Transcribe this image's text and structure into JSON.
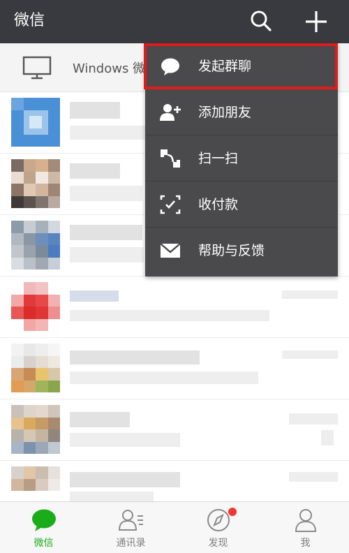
{
  "header": {
    "title": "微信",
    "search_icon": "search-icon",
    "add_icon": "plus-icon"
  },
  "banner": {
    "text": "Windows 微",
    "icon": "monitor-icon"
  },
  "menu": {
    "items": [
      {
        "label": "发起群聊",
        "icon": "chat-bubble-icon",
        "highlighted": true
      },
      {
        "label": "添加朋友",
        "icon": "add-friend-icon",
        "highlighted": false
      },
      {
        "label": "扫一扫",
        "icon": "scan-icon",
        "highlighted": false
      },
      {
        "label": "收付款",
        "icon": "payment-icon",
        "highlighted": false
      },
      {
        "label": "帮助与反馈",
        "icon": "envelope-icon",
        "highlighted": false
      }
    ],
    "highlight_color": "#e01b1b"
  },
  "tabbar": {
    "tabs": [
      {
        "label": "微信",
        "icon": "chat-icon",
        "active": true
      },
      {
        "label": "通讯录",
        "icon": "contacts-icon",
        "active": false
      },
      {
        "label": "发现",
        "icon": "compass-icon",
        "active": false,
        "badge": true
      },
      {
        "label": "我",
        "icon": "profile-icon",
        "active": false
      }
    ],
    "active_color": "#1aad19"
  },
  "colors": {
    "header_bg": "#393a3f",
    "menu_bg": "#4a4a4c",
    "badge": "#f43530"
  }
}
